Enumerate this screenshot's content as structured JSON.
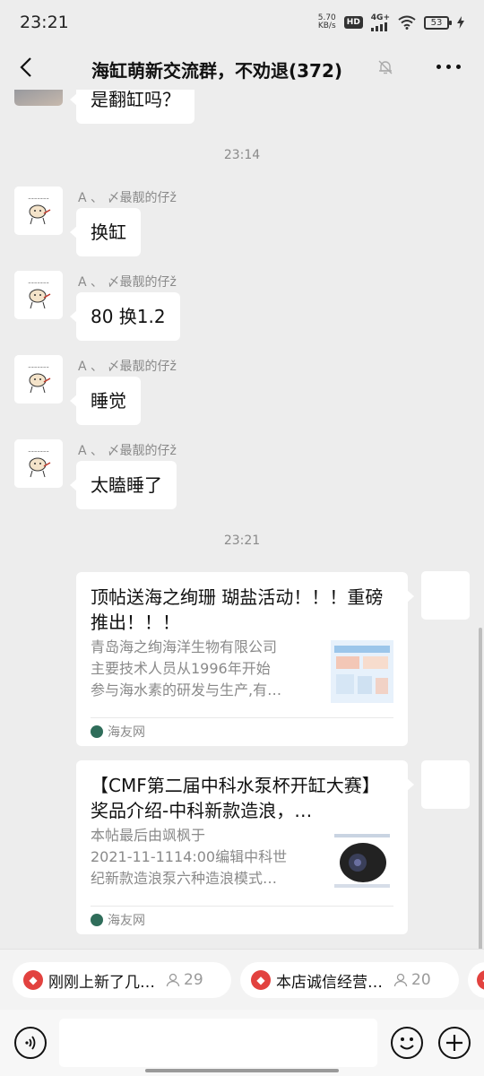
{
  "status": {
    "time": "23:21",
    "speed_value": "5.70",
    "speed_unit": "KB/s",
    "hd": "HD",
    "network": "4G+",
    "battery": "53"
  },
  "header": {
    "title": "海缸萌新交流群，不劝退(372)"
  },
  "chat": {
    "partial_message": "是翻缸吗？",
    "timestamps": [
      "23:14",
      "23:21"
    ],
    "messages": [
      {
        "sender": "A  、    〆最靓的仔ž",
        "text": "换缸"
      },
      {
        "sender": "A  、    〆最靓的仔ž",
        "text": "80 换1.2"
      },
      {
        "sender": "A  、    〆最靓的仔ž",
        "text": "睡觉"
      },
      {
        "sender": "A  、    〆最靓的仔ž",
        "text": "太瞌睡了"
      }
    ],
    "cards": [
      {
        "title": "顶帖送海之绚珊 瑚盐活动！！！重磅推出！！！",
        "desc": [
          "青岛海之绚海洋生物有限公司",
          "主要技术人员从1996年开始",
          "参与海水素的研发与生产,有…"
        ],
        "source": "海友网"
      },
      {
        "title": "【CMF第二届中科水泵杯开缸大赛】奖品介绍-中科新款造浪，…",
        "desc": [
          "本帖最后由飒枫于",
          "2021-11-1114:00编辑中科世",
          "纪新款造浪泵六种造浪模式…"
        ],
        "source": "海友网"
      }
    ]
  },
  "quickbar": [
    {
      "text": "刚刚上新了几…",
      "count": "29"
    },
    {
      "text": "本店诚信经营…",
      "count": "20"
    }
  ],
  "input": {
    "placeholder": ""
  },
  "colors": {
    "background": "#ededed",
    "bubble": "#ffffff",
    "accent_red": "#e2423f"
  }
}
